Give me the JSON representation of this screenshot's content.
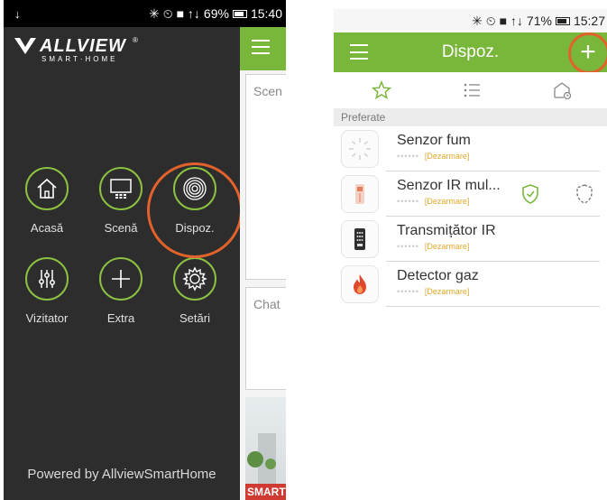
{
  "left_screen": {
    "statusbar": {
      "download_indicator": "↓",
      "signal_icons": "✳ ⏲ ■ ↑↓",
      "battery": "69%",
      "time": "15:40"
    },
    "brand": {
      "name": "ALLVIEW",
      "reg": "®",
      "subtitle": "SMART·HOME"
    },
    "menu": [
      {
        "label": "Acasă",
        "icon": "house-icon"
      },
      {
        "label": "Scenă",
        "icon": "scene-panel-icon"
      },
      {
        "label": "Dispoz.",
        "icon": "device-fingerprint-icon"
      },
      {
        "label": "Vizitator",
        "icon": "sliders-icon"
      },
      {
        "label": "Extra",
        "icon": "plus-icon"
      },
      {
        "label": "Setări",
        "icon": "gear-icon"
      }
    ],
    "footer": "Powered by AllviewSmartHome",
    "background_panel": {
      "card1": "Scen",
      "card2": "Chat",
      "banner_text": "SMART"
    },
    "highlight_color": "#e2622b",
    "accent_color": "#79b73b"
  },
  "right_screen": {
    "statusbar": {
      "signal_icons": "✳ ⏲ ■ ↑↓",
      "battery": "71%",
      "time": "15:27"
    },
    "appbar": {
      "title": "Dispoz.",
      "add_label": "+"
    },
    "tabs": [
      "star-icon",
      "list-icon",
      "home-clock-icon"
    ],
    "section": "Preferate",
    "devices": [
      {
        "name": "Senzor fum",
        "status_dots": "••••••",
        "status": "[Dezarmare]",
        "icon": "smoke-sensor-icon"
      },
      {
        "name": "Senzor IR mul...",
        "status_dots": "••••••",
        "status": "[Dezarmare]",
        "icon": "ir-sensor-icon",
        "actions": [
          "armed-shield-icon",
          "disarmed-shield-icon"
        ]
      },
      {
        "name": "Transmițător IR",
        "status_dots": "••••••",
        "status": "[Dezarmare]",
        "icon": "remote-control-icon"
      },
      {
        "name": "Detector gaz",
        "status_dots": "••••••",
        "status": "[Dezarmare]",
        "icon": "gas-flame-icon"
      }
    ]
  }
}
